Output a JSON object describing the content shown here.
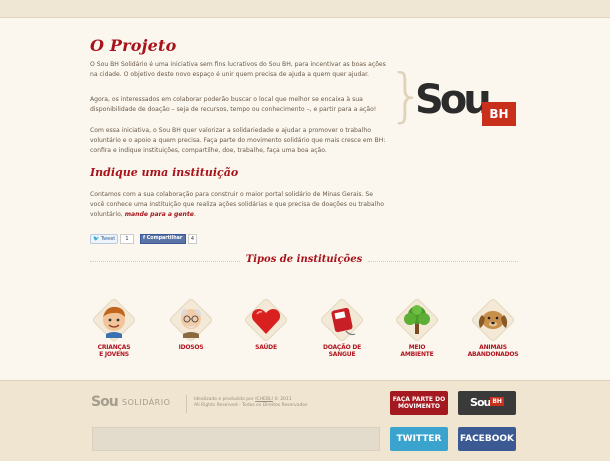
{
  "main": {
    "title": "O Projeto",
    "paragraph1": "O Sou BH Solidário é uma iniciativa sem fins lucrativos do Sou BH, para incentivar as boas ações na cidade. O objetivo deste novo espaço é unir quem precisa de ajuda a quem quer ajudar.",
    "paragraph2": "Agora, os interessados em colaborar poderão buscar o local que melhor se encaixa à sua disponibilidade de doação – seja de recursos, tempo ou conhecimento –, e partir para a ação!",
    "paragraph3": "Com essa iniciativa, o Sou BH quer valorizar a solidariedade e ajudar a promover o trabalho voluntário e o apoio a quem precisa. Faça parte do movimento solidário que mais cresce em BH: confira e indique instituições, compartilhe, doe, trabalhe, faça uma boa ação.",
    "subtitle": "Indique uma instituição",
    "paragraph4": "Contamos com a sua colaboração para construir o maior portal solidário de Minas Gerais. Se você conhece uma instituição que realiza ações solidárias e que precisa de doações ou trabalho voluntário,",
    "paragraph4_link": "mande para a gente"
  },
  "logo": {
    "sou": "Sou",
    "bh": "BH"
  },
  "social": {
    "tweet_label": "Tweet",
    "tweet_count": "1",
    "share_label": "Compartilhar",
    "share_count": "4"
  },
  "types": {
    "title": "Tipos de instituições",
    "items": [
      {
        "line1": "CRIANÇAS",
        "line2": "E JOVENS",
        "icon": "children-icon"
      },
      {
        "line1": "IDOSOS",
        "line2": "",
        "icon": "elderly-icon"
      },
      {
        "line1": "SAÚDE",
        "line2": "",
        "icon": "heart-icon"
      },
      {
        "line1": "DOAÇÃO DE",
        "line2": "SANGUE",
        "icon": "blood-bag-icon"
      },
      {
        "line1": "MEIO",
        "line2": "AMBIENTE",
        "icon": "tree-icon"
      },
      {
        "line1": "ANIMAIS",
        "line2": "ABANDONADOS",
        "icon": "dog-icon"
      }
    ]
  },
  "footer": {
    "logo_sou": "Sou",
    "logo_solidario": "SOLIDÁRIO",
    "credit_line1": "Idealizado e produzido por",
    "credit_company": "ICHEBLI",
    "credit_year": "© 2011",
    "credit_line2": "All Rights Reserved - Todos os Direitos Reservados",
    "btn_parte_line1": "FAÇA PARTE DO",
    "btn_parte_line2": "MOVIMENTO",
    "btn_sou": "Sou",
    "btn_bh": "BH",
    "btn_twitter": "TWITTER",
    "btn_facebook": "FACEBOOK"
  },
  "colors": {
    "accent": "#a7121b",
    "twitter": "#3aa4cf",
    "facebook": "#3b5a94"
  }
}
